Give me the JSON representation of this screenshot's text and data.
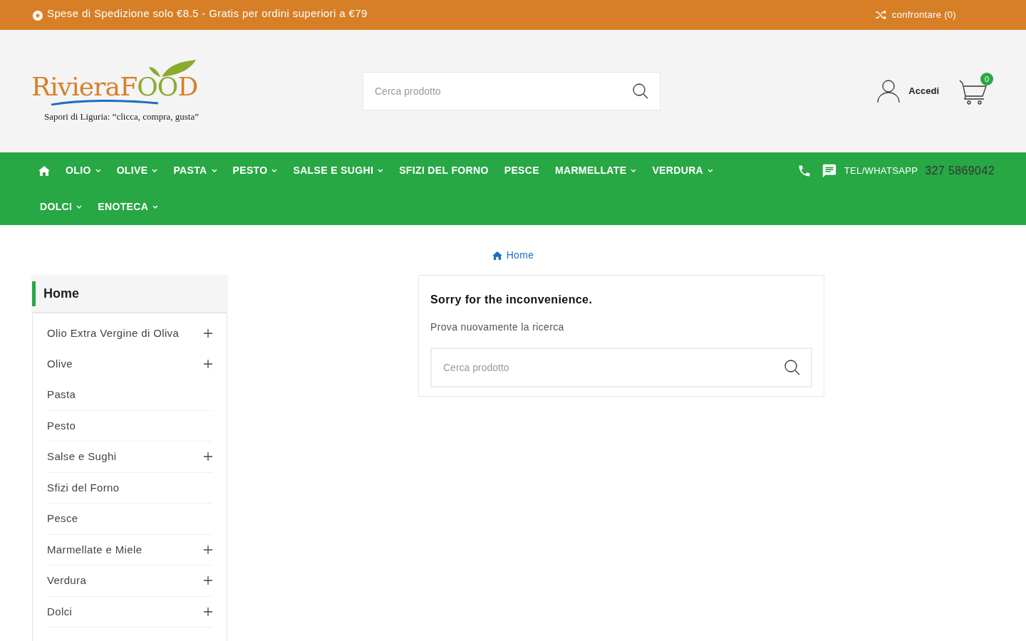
{
  "top_bar": {
    "shipping_notice": "Spese di Spedizione solo €8.5 - Gratis per ordini superiori a €79",
    "compare_link": "confrontare (0)"
  },
  "header": {
    "logo": {
      "word_1": "Riviera",
      "word_2": "F",
      "word_3": "OO",
      "word_4": "D",
      "tagline": "Sapori di Liguria: “clicca, compra, gusta”"
    },
    "search": {
      "placeholder": "Cerca prodotto"
    },
    "login": "Accedi",
    "cart_count": "0"
  },
  "nav": {
    "items": [
      {
        "label": "OLIO",
        "dropdown": true
      },
      {
        "label": "OLIVE",
        "dropdown": true
      },
      {
        "label": "PASTA",
        "dropdown": true
      },
      {
        "label": "PESTO",
        "dropdown": true
      },
      {
        "label": "SALSE E SUGHI",
        "dropdown": true
      },
      {
        "label": "SFIZI DEL FORNO",
        "dropdown": false
      },
      {
        "label": "PESCE",
        "dropdown": false
      },
      {
        "label": "MARMELLATE",
        "dropdown": true
      },
      {
        "label": "VERDURA",
        "dropdown": true
      },
      {
        "label": "DOLCI",
        "dropdown": true
      },
      {
        "label": "ENOTECA",
        "dropdown": true
      }
    ],
    "contact_label": "TEL/WHATSAPP",
    "phone": "327 5869042"
  },
  "breadcrumb": [
    "Home"
  ],
  "sidebar": {
    "title": "Home",
    "items": [
      {
        "label": "Olio Extra Vergine di Oliva",
        "expandable": true
      },
      {
        "label": "Olive",
        "expandable": true
      },
      {
        "label": "Pasta",
        "expandable": false
      },
      {
        "label": "Pesto",
        "expandable": false
      },
      {
        "label": "Salse e Sughi",
        "expandable": true
      },
      {
        "label": "Sfizi del Forno",
        "expandable": false
      },
      {
        "label": "Pesce",
        "expandable": false
      },
      {
        "label": "Marmellate e Miele",
        "expandable": true
      },
      {
        "label": "Verdura",
        "expandable": true
      },
      {
        "label": "Dolci",
        "expandable": true
      }
    ]
  },
  "notice": {
    "title": "Sorry for the inconvenience.",
    "message": "Prova nuovamente la ricerca",
    "search": {
      "placeholder": "Cerca prodotto"
    }
  }
}
